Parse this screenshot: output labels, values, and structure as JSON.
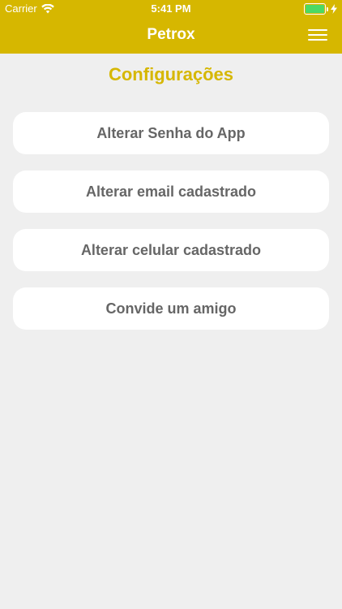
{
  "status_bar": {
    "carrier": "Carrier",
    "time": "5:41 PM",
    "battery_color": "#4cd964"
  },
  "nav": {
    "title": "Petrox",
    "menu_icon": "hamburger-menu-icon",
    "background_color": "#d6b700"
  },
  "page": {
    "title": "Configurações",
    "title_color": "#d6b700"
  },
  "options": [
    {
      "label": "Alterar Senha do App"
    },
    {
      "label": "Alterar email cadastrado"
    },
    {
      "label": "Alterar celular cadastrado"
    },
    {
      "label": "Convide um amigo"
    }
  ]
}
